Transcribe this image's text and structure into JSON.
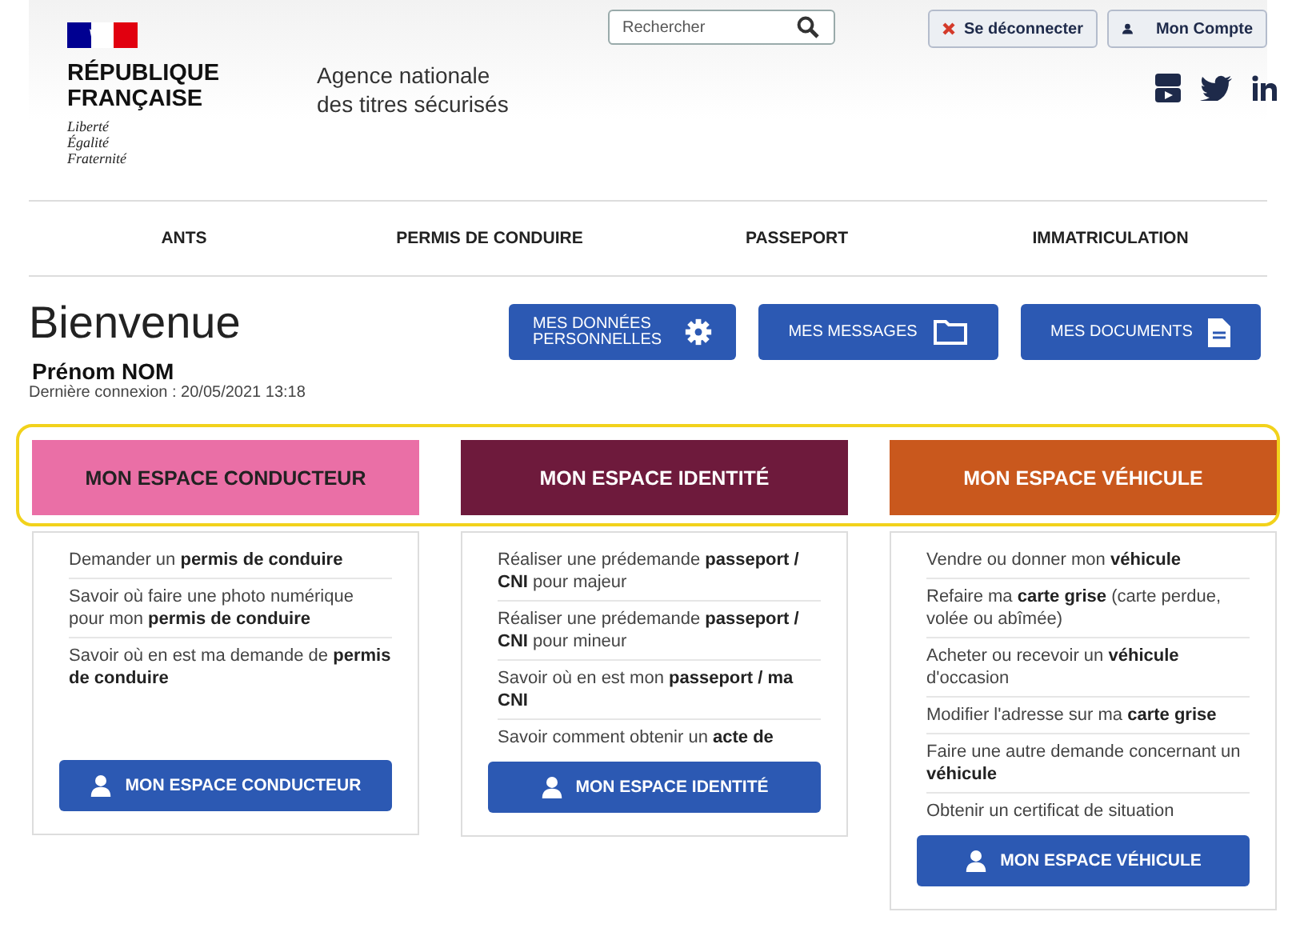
{
  "header": {
    "republic": [
      "RÉPUBLIQUE",
      "FRANÇAISE"
    ],
    "motto": [
      "Liberté",
      "Égalité",
      "Fraternité"
    ],
    "agency": [
      "Agence nationale",
      "des titres sécurisés"
    ],
    "search": {
      "placeholder": "Rechercher"
    },
    "logout": "Se déconnecter",
    "account": "Mon Compte"
  },
  "nav": [
    "ANTS",
    "PERMIS DE CONDUIRE",
    "PASSEPORT",
    "IMMATRICULATION"
  ],
  "welcome": {
    "title": "Bienvenue",
    "name": "Prénom NOM",
    "last_login": "Dernière connexion : 20/05/2021 13:18"
  },
  "quick_buttons": [
    {
      "kind": "settings",
      "label": "MES DONNÉES PERSONNELLES"
    },
    {
      "kind": "folder",
      "label": "MES MESSAGES"
    },
    {
      "kind": "document",
      "label": "MES DOCUMENTS"
    }
  ],
  "spaces": [
    {
      "title": "MON ESPACE CONDUCTEUR",
      "color": "#ea6fa6",
      "items": [
        "Demander un **permis de conduire**",
        "Savoir où faire une photo numérique pour mon **permis de conduire**",
        "Savoir où en est ma demande de **permis de conduire**"
      ],
      "button": "MON ESPACE CONDUCTEUR"
    },
    {
      "title": "MON ESPACE IDENTITÉ",
      "color": "#6e1a3c",
      "items": [
        "Réaliser une prédemande **passeport / CNI** pour majeur",
        "Réaliser une prédemande **passeport / CNI** pour mineur",
        "Savoir où en est mon **passeport / ma CNI**",
        "Savoir comment obtenir un **acte de**"
      ],
      "button": "MON ESPACE IDENTITÉ"
    },
    {
      "title": "MON ESPACE VÉHICULE",
      "color": "#c9581d",
      "items": [
        "Vendre ou donner mon **véhicule**",
        "Refaire ma **carte grise** (carte perdue, volée ou abîmée)",
        "Acheter ou recevoir un **véhicule** d'occasion",
        "Modifier l'adresse sur ma **carte grise**",
        "Faire une autre demande concernant un **véhicule**",
        "Obtenir un certificat de situation"
      ],
      "button": "MON ESPACE VÉHICULE"
    }
  ]
}
